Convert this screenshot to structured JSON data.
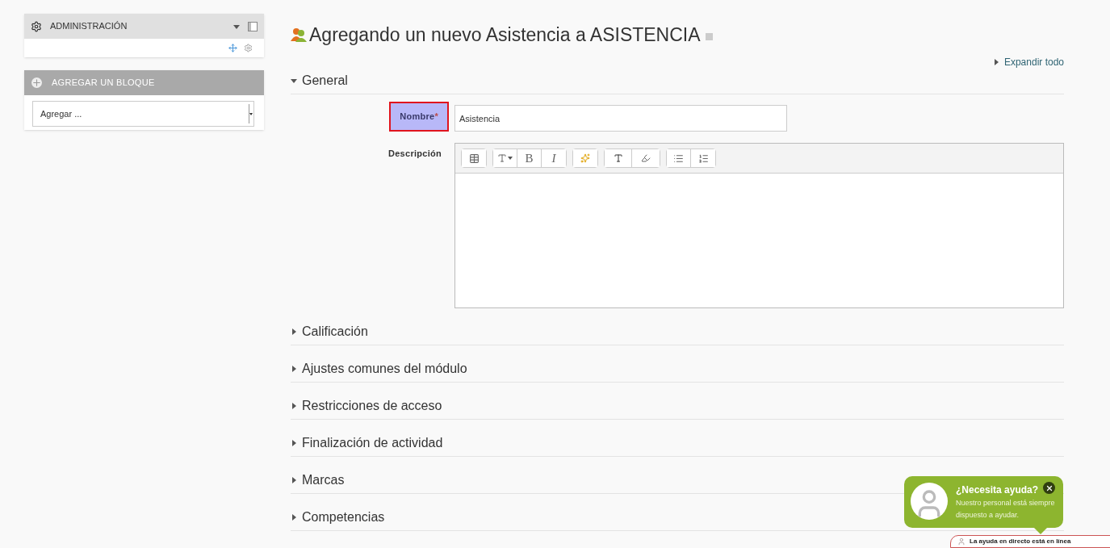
{
  "sidebar": {
    "admin_block": {
      "title": "ADMINISTRACIÓN"
    },
    "add_block": {
      "title": "AGREGAR UN BLOQUE",
      "select_value": "Agregar ..."
    }
  },
  "page_title": "Agregando un nuevo Asistencia a ASISTENCIA",
  "expand_all": "Expandir todo",
  "sections": [
    {
      "title": "General",
      "expanded": true
    },
    {
      "title": "Calificación",
      "expanded": false
    },
    {
      "title": "Ajustes comunes del módulo",
      "expanded": false
    },
    {
      "title": "Restricciones de acceso",
      "expanded": false
    },
    {
      "title": "Finalización de actividad",
      "expanded": false
    },
    {
      "title": "Marcas",
      "expanded": false
    },
    {
      "title": "Competencias",
      "expanded": false
    }
  ],
  "form": {
    "name_label": "Nombre",
    "required_mark": "*",
    "name_highlighted": true,
    "name_value": "Asistencia",
    "description_label": "Descripción",
    "toolbar": {
      "bold": "B",
      "italic": "I"
    }
  },
  "help_widget": {
    "title": "¿Necesita ayuda?",
    "message": "Nuestro personal está siempre dispuesto a ayudar.",
    "status": "La ayuda en directo está en línea"
  }
}
